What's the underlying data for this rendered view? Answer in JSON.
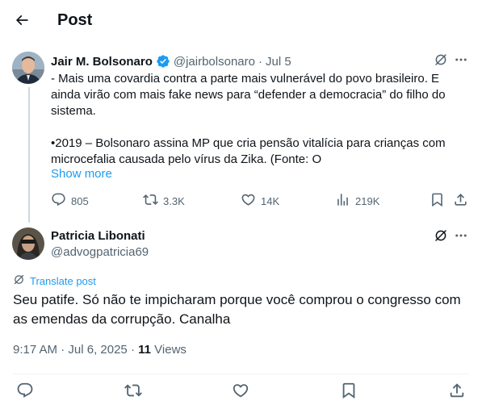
{
  "header": {
    "title": "Post",
    "back_icon": "arrow-left-icon"
  },
  "original_post": {
    "author_name": "Jair M. Bolsonaro",
    "handle": "@jairbolsonaro",
    "separator": "·",
    "date": "Jul 5",
    "verified": true,
    "verified_color": "#1d9bf0",
    "paragraph_1": "- Mais uma covardia contra a parte mais vulnerável do povo brasileiro. E ainda virão com mais fake news para “defender a democracia” do filho do sistema.",
    "paragraph_2": "•2019 – Bolsonaro assina MP que cria pensão vitalícia para crianças com microcefalia causada pelo vírus da Zika. (Fonte: O",
    "show_more": "Show more",
    "stats": {
      "replies": "805",
      "reposts": "3.3K",
      "likes": "14K",
      "views": "219K"
    }
  },
  "reply": {
    "author_name": "Patricia Libonati",
    "handle": "@advogpatricia69",
    "translate_label": "Translate post",
    "text": "Seu patife. Só não te impicharam porque você comprou o congresso com as emendas da corrupção. Canalha",
    "time": "9:17 AM",
    "separator": "·",
    "date": "Jul 6, 2025",
    "separator_2": "·",
    "views_count": "11",
    "views_label": "Views"
  },
  "colors": {
    "accent": "#1d9bf0",
    "text": "#0f1419",
    "muted": "#536471",
    "divider": "#eff3f4"
  }
}
